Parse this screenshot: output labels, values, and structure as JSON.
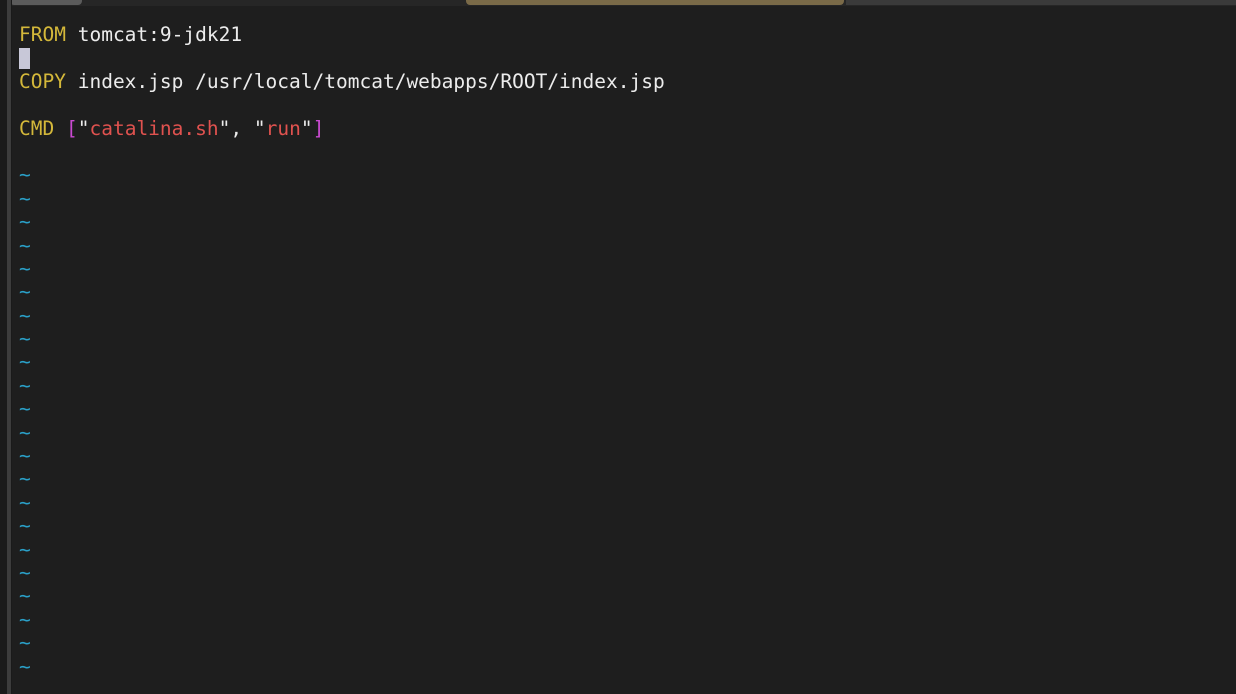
{
  "editor": {
    "lines": [
      {
        "keyword": "FROM",
        "rest": "tomcat:9-jdk21"
      },
      {
        "keyword": "COPY",
        "rest": "index.jsp /usr/local/tomcat/webapps/ROOT/index.jsp"
      },
      {
        "keyword": "CMD",
        "open_bracket": "[",
        "q1": "\"",
        "arg1": "catalina.sh",
        "q2": "\"",
        "sep": ", ",
        "q3": "\"",
        "arg2": "run",
        "q4": "\"",
        "close_bracket": "]"
      }
    ],
    "empty_line_marker": "~"
  },
  "colors": {
    "background": "#1e1e1e",
    "keyword": "#d4b83a",
    "string": "#e0524f",
    "bracket": "#c94ad1",
    "tilde": "#2aa0c8",
    "accent_tab": "#7a6a48"
  }
}
